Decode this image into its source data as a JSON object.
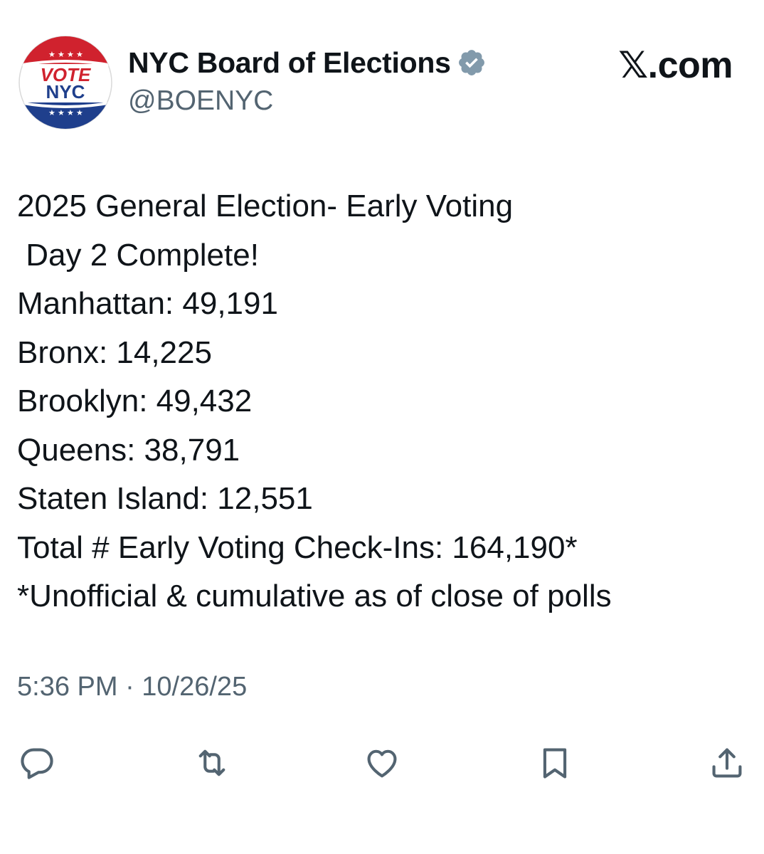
{
  "account": {
    "display_name": "NYC Board of Elections",
    "handle": "@BOENYC",
    "avatar_line1": "VOTE",
    "avatar_line2": "NYC",
    "verified_icon": "verified-badge-icon"
  },
  "site_mark": "𝕏.com",
  "tweet": {
    "lines": [
      "2025 General Election- Early Voting",
      " Day 2 Complete!",
      "Manhattan: 49,191",
      "Bronx: 14,225",
      "Brooklyn: 49,432",
      "Queens: 38,791",
      "Staten Island: 12,551",
      "Total # Early Voting Check-Ins: 164,190*",
      "*Unofficial & cumulative as of close of polls"
    ],
    "timestamp": "5:36 PM · 10/26/25"
  },
  "actions": [
    {
      "name": "reply",
      "icon": "reply-icon"
    },
    {
      "name": "repost",
      "icon": "repost-icon"
    },
    {
      "name": "like",
      "icon": "heart-icon"
    },
    {
      "name": "bookmark",
      "icon": "bookmark-icon"
    },
    {
      "name": "share",
      "icon": "share-icon"
    }
  ],
  "colors": {
    "text": "#0f1419",
    "secondary": "#536471",
    "verified": "#829aab",
    "avatar_red": "#d0222e",
    "avatar_blue": "#1f3f8c"
  }
}
